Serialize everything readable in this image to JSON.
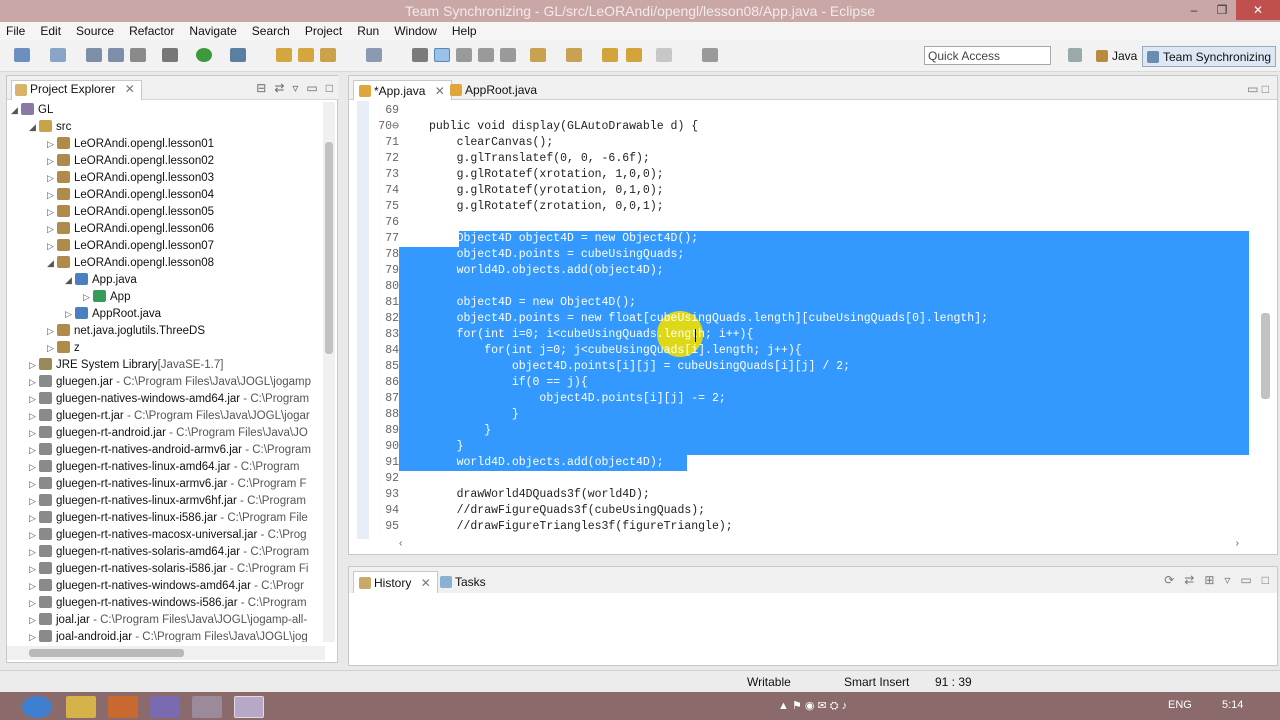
{
  "window": {
    "title": "Team Synchronizing - GL/src/LeORAndi/opengl/lesson08/App.java - Eclipse",
    "min": "–",
    "max": "❐",
    "close": "✕"
  },
  "menu": [
    "File",
    "Edit",
    "Source",
    "Refactor",
    "Navigate",
    "Search",
    "Project",
    "Run",
    "Window",
    "Help"
  ],
  "toolbar": {
    "quick_access_placeholder": "Quick Access",
    "perspectives": [
      "Java",
      "Team Synchronizing"
    ]
  },
  "explorer": {
    "tab_label": "Project Explorer",
    "items": [
      {
        "label": "GL",
        "path": ""
      },
      {
        "label": "src",
        "path": ""
      },
      {
        "label": "LeORAndi.opengl.lesson01",
        "path": ""
      },
      {
        "label": "LeORAndi.opengl.lesson02",
        "path": ""
      },
      {
        "label": "LeORAndi.opengl.lesson03",
        "path": ""
      },
      {
        "label": "LeORAndi.opengl.lesson04",
        "path": ""
      },
      {
        "label": "LeORAndi.opengl.lesson05",
        "path": ""
      },
      {
        "label": "LeORAndi.opengl.lesson06",
        "path": ""
      },
      {
        "label": "LeORAndi.opengl.lesson07",
        "path": ""
      },
      {
        "label": "LeORAndi.opengl.lesson08",
        "path": ""
      },
      {
        "label": "App.java",
        "path": ""
      },
      {
        "label": "App",
        "path": ""
      },
      {
        "label": "AppRoot.java",
        "path": ""
      },
      {
        "label": "net.java.joglutils.ThreeDS",
        "path": ""
      },
      {
        "label": "z",
        "path": ""
      },
      {
        "label": "JRE System Library",
        "path": "[JavaSE-1.7]"
      },
      {
        "label": "gluegen.jar",
        "path": " - C:\\Program Files\\Java\\JOGL\\jogamp"
      },
      {
        "label": "gluegen-natives-windows-amd64.jar",
        "path": " - C:\\Program"
      },
      {
        "label": "gluegen-rt.jar",
        "path": " - C:\\Program Files\\Java\\JOGL\\jogar"
      },
      {
        "label": "gluegen-rt-android.jar",
        "path": " - C:\\Program Files\\Java\\JO"
      },
      {
        "label": "gluegen-rt-natives-android-armv6.jar",
        "path": " - C:\\Program"
      },
      {
        "label": "gluegen-rt-natives-linux-amd64.jar",
        "path": " - C:\\Program"
      },
      {
        "label": "gluegen-rt-natives-linux-armv6.jar",
        "path": " - C:\\Program F"
      },
      {
        "label": "gluegen-rt-natives-linux-armv6hf.jar",
        "path": " - C:\\Program"
      },
      {
        "label": "gluegen-rt-natives-linux-i586.jar",
        "path": " - C:\\Program File"
      },
      {
        "label": "gluegen-rt-natives-macosx-universal.jar",
        "path": " - C:\\Prog"
      },
      {
        "label": "gluegen-rt-natives-solaris-amd64.jar",
        "path": " - C:\\Program"
      },
      {
        "label": "gluegen-rt-natives-solaris-i586.jar",
        "path": " - C:\\Program Fi"
      },
      {
        "label": "gluegen-rt-natives-windows-amd64.jar",
        "path": " - C:\\Progr"
      },
      {
        "label": "gluegen-rt-natives-windows-i586.jar",
        "path": " - C:\\Program"
      },
      {
        "label": "joal.jar",
        "path": " - C:\\Program Files\\Java\\JOGL\\jogamp-all-"
      },
      {
        "label": "joal-android.jar",
        "path": " - C:\\Program Files\\Java\\JOGL\\jog"
      }
    ]
  },
  "editor": {
    "tabs": [
      "*App.java",
      "AppRoot.java"
    ],
    "lines": [
      {
        "n": "69",
        "code": ""
      },
      {
        "n": "70⊖",
        "code": "public void display(GLAutoDrawable d) {"
      },
      {
        "n": "71",
        "code": "    clearCanvas();"
      },
      {
        "n": "72",
        "code": "    g.glTranslatef(0, 0, -6.6f);"
      },
      {
        "n": "73",
        "code": "    g.glRotatef(xrotation, 1,0,0);"
      },
      {
        "n": "74",
        "code": "    g.glRotatef(yrotation, 0,1,0);"
      },
      {
        "n": "75",
        "code": "    g.glRotatef(zrotation, 0,0,1);"
      },
      {
        "n": "76",
        "code": ""
      },
      {
        "n": "77",
        "code": "    Object4D object4D = new Object4D();"
      },
      {
        "n": "78",
        "code": "    object4D.points = cubeUsingQuads;"
      },
      {
        "n": "79",
        "code": "    world4D.objects.add(object4D);"
      },
      {
        "n": "80",
        "code": ""
      },
      {
        "n": "81",
        "code": "    object4D = new Object4D();"
      },
      {
        "n": "82",
        "code": "    object4D.points = new float[cubeUsingQuads.length][cubeUsingQuads[0].length];"
      },
      {
        "n": "83",
        "code": "    for(int i=0; i<cubeUsingQuads.length; i++){"
      },
      {
        "n": "84",
        "code": "        for(int j=0; j<cubeUsingQuads[i].length; j++){"
      },
      {
        "n": "85",
        "code": "            object4D.points[i][j] = cubeUsingQuads[i][j] / 2;"
      },
      {
        "n": "86",
        "code": "            if(0 == j){"
      },
      {
        "n": "87",
        "code": "                object4D.points[i][j] -= 2;"
      },
      {
        "n": "88",
        "code": "            }"
      },
      {
        "n": "89",
        "code": "        }"
      },
      {
        "n": "90",
        "code": "    }"
      },
      {
        "n": "91",
        "code": "    world4D.objects.add(object4D);"
      },
      {
        "n": "92",
        "code": ""
      },
      {
        "n": "93",
        "code": "    drawWorld4DQuads3f(world4D);"
      },
      {
        "n": "94",
        "code": "    //drawFigureQuads3f(cubeUsingQuads);"
      },
      {
        "n": "95",
        "code": "    //drawFigureTriangles3f(figureTriangle);"
      }
    ]
  },
  "bottom": {
    "tabs": [
      "History",
      "Tasks"
    ]
  },
  "status": {
    "writable": "Writable",
    "insert": "Smart Insert",
    "position": "91 : 39"
  },
  "taskbar": {
    "lang": "ENG",
    "time": "5:14"
  }
}
